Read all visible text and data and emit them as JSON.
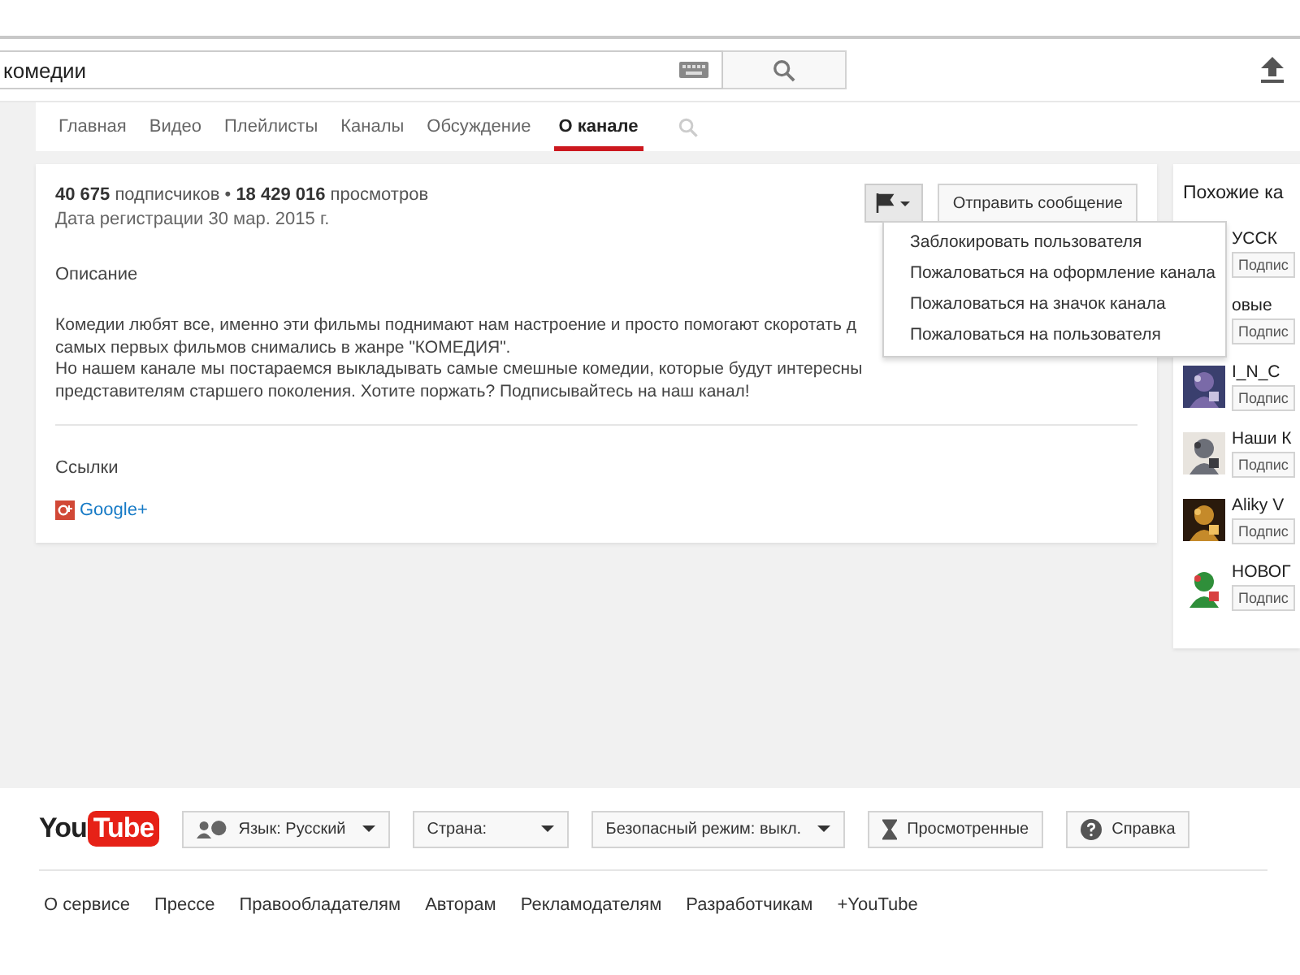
{
  "search": {
    "value": "комедии"
  },
  "tabs": [
    {
      "label": "Главная",
      "selected": false
    },
    {
      "label": "Видео",
      "selected": false
    },
    {
      "label": "Плейлисты",
      "selected": false
    },
    {
      "label": "Каналы",
      "selected": false
    },
    {
      "label": "Обсуждение",
      "selected": false
    },
    {
      "label": "О канале",
      "selected": true
    }
  ],
  "about": {
    "stats": "**40 675** подписчиков • **18 429 016** просмотров",
    "registered": "Дата регистрации 30 мар. 2015 г.",
    "description_heading": "Описание",
    "description_lines": [
      "Комедии любят все, именно эти фильмы поднимают нам настроение и просто помогают скоротать д",
      "самых первых фильмов снимались в жанре \"КОМЕДИЯ\".",
      "Но нашем канале мы постараемся выкладывать самые смешные комедии, которые будут интересны",
      "представителям старшего поколения. Хотите поржать? Подписывайтесь на наш канал!"
    ],
    "links_heading": "Ссылки",
    "link": "Google+",
    "message_button": "Отправить сообщение"
  },
  "flag_menu": [
    "Заблокировать пользователя",
    "Пожаловаться на оформление канала",
    "Пожаловаться на значок канала",
    "Пожаловаться на пользователя"
  ],
  "related": {
    "title": "Похожие ка",
    "channels": [
      {
        "name": "УССК",
        "button": "Подпис"
      },
      {
        "name": "овые",
        "button": "Подпис"
      },
      {
        "name": "I_N_C",
        "button": "Подпис",
        "avatar": true
      },
      {
        "name": "Наши К",
        "button": "Подпис",
        "avatar": true
      },
      {
        "name": "Aliky V",
        "button": "Подпис",
        "avatar": true
      },
      {
        "name": "НОВОГ",
        "button": "Подпис",
        "avatar": true
      }
    ]
  },
  "footer": {
    "logo": [
      "You",
      "Tube"
    ],
    "language": "Язык: Русский",
    "country": "Страна:",
    "safety": "Безопасный режим: выкл.",
    "history": "Просмотренные",
    "help": "Справка",
    "links": [
      "О сервисе",
      "Прессе",
      "Правообладателям",
      "Авторам",
      "Рекламодателям",
      "Разработчикам",
      "+YouTube"
    ]
  }
}
